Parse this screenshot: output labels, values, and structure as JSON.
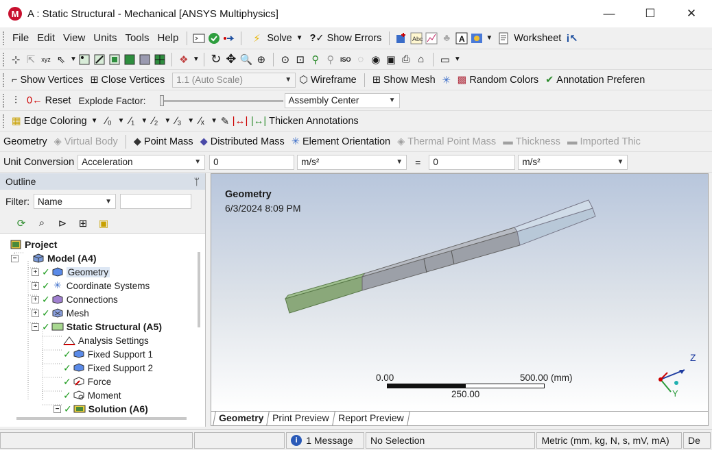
{
  "window": {
    "app_logo": "M",
    "title": "A : Static Structural - Mechanical [ANSYS Multiphysics]",
    "controls": [
      "—",
      "☐",
      "✕"
    ]
  },
  "menu": [
    "File",
    "Edit",
    "View",
    "Units",
    "Tools",
    "Help"
  ],
  "toolbar1": {
    "solve_label": "Solve",
    "show_errors_label": "Show Errors",
    "worksheet_label": "Worksheet"
  },
  "toolbar3": {
    "show_vertices": "Show Vertices",
    "close_vertices": "Close Vertices",
    "scale_value": "1.1 (Auto Scale)",
    "wireframe": "Wireframe",
    "show_mesh": "Show Mesh",
    "random_colors": "Random Colors",
    "annotation_prefs": "Annotation Preferen"
  },
  "toolbar4": {
    "reset": "Reset",
    "explode_factor": "Explode Factor:",
    "assembly_center": "Assembly Center"
  },
  "toolbar5": {
    "edge_coloring": "Edge Coloring",
    "thicken_annotations": "Thicken Annotations"
  },
  "toolbar6": {
    "geometry": "Geometry",
    "virtual_body": "Virtual Body",
    "point_mass": "Point Mass",
    "distributed_mass": "Distributed Mass",
    "element_orientation": "Element Orientation",
    "thermal_point_mass": "Thermal Point Mass",
    "thickness": "Thickness",
    "imported_thickness": "Imported Thic"
  },
  "unit_conversion": {
    "label": "Unit Conversion",
    "quantity": "Acceleration",
    "left_value": "0",
    "left_unit": "m/s²",
    "equals": "=",
    "right_value": "0",
    "right_unit": "m/s²"
  },
  "outline": {
    "title": "Outline",
    "pin": "ᛘ",
    "filter_label": "Filter:",
    "filter_value": "Name",
    "tree": [
      {
        "label": "Project"
      },
      {
        "label": "Model (A4)"
      },
      {
        "label": "Geometry"
      },
      {
        "label": "Coordinate Systems"
      },
      {
        "label": "Connections"
      },
      {
        "label": "Mesh"
      },
      {
        "label": "Static Structural (A5)"
      },
      {
        "label": "Analysis Settings"
      },
      {
        "label": "Fixed Support 1"
      },
      {
        "label": "Fixed Support 2"
      },
      {
        "label": "Force"
      },
      {
        "label": "Moment"
      },
      {
        "label": "Solution (A6)"
      }
    ]
  },
  "viewport": {
    "title": "Geometry",
    "date": "6/3/2024 8:09 PM",
    "scale_left": "0.00",
    "scale_right": "500.00 (mm)",
    "scale_mid": "250.00",
    "axis_z": "Z",
    "axis_y": "Y"
  },
  "view_tabs": [
    "Geometry",
    "Print Preview",
    "Report Preview"
  ],
  "status": {
    "messages": "1 Message",
    "selection": "No Selection",
    "units": "Metric (mm, kg, N, s, mV, mA)",
    "extra": "De"
  }
}
